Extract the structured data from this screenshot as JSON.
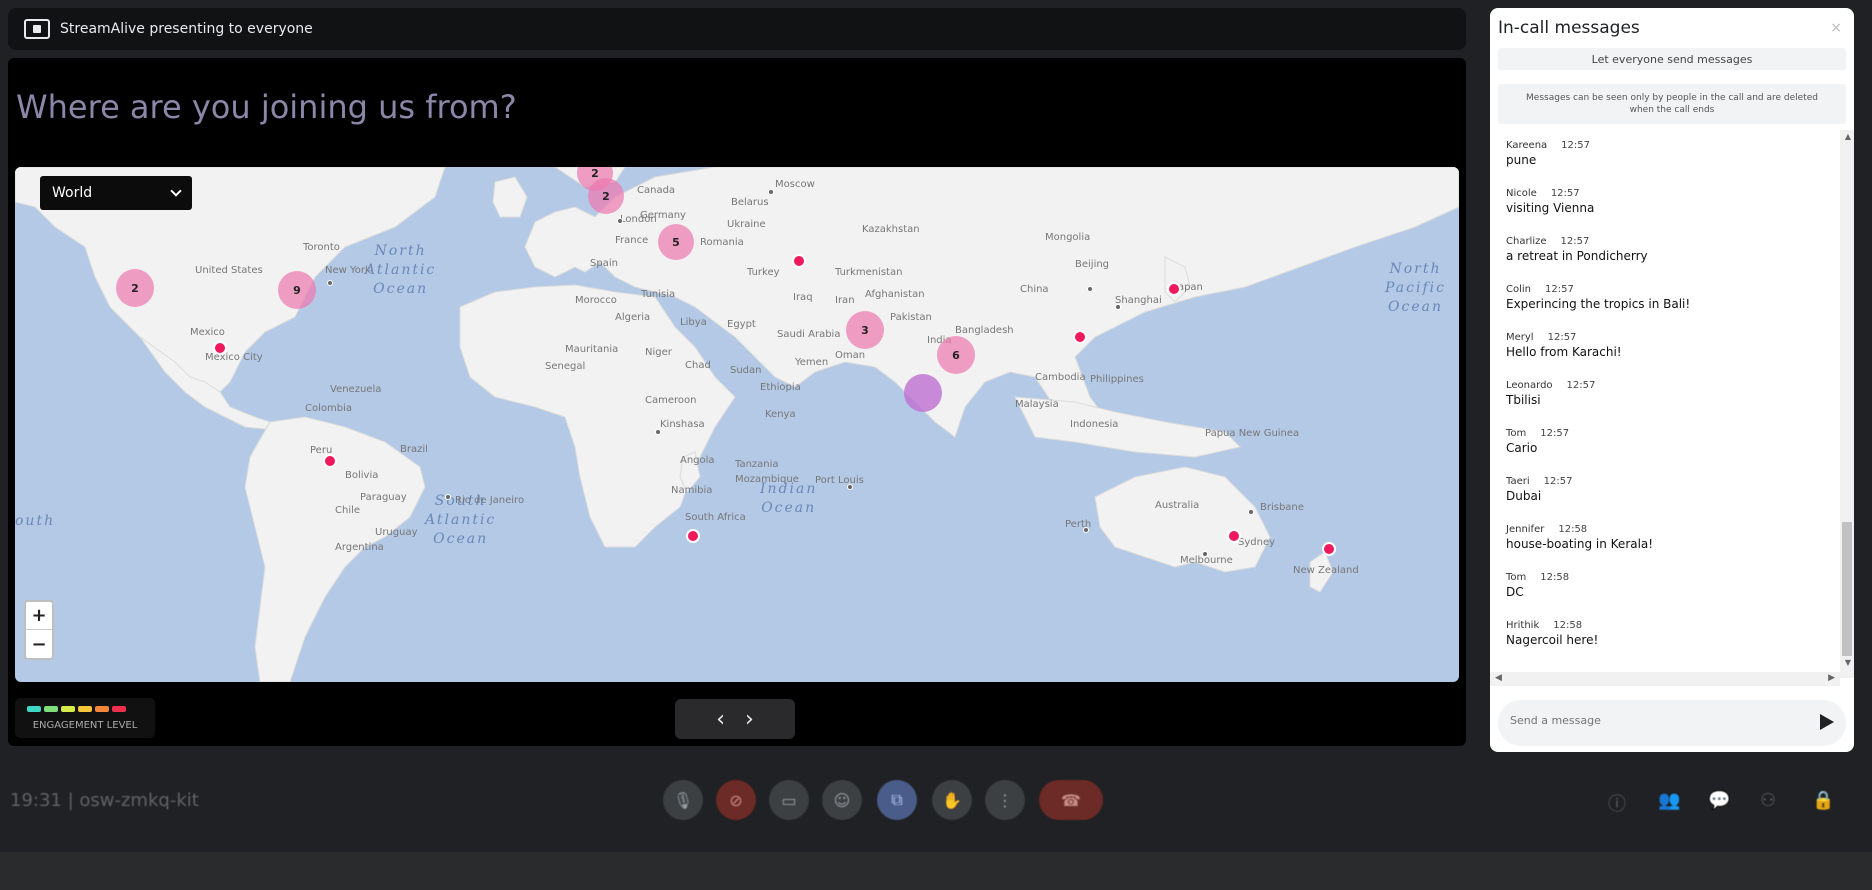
{
  "presenting": {
    "text": "StreamAlive presenting to everyone"
  },
  "stage": {
    "title": "Where are you joining us from?",
    "region_select": "World",
    "zoom_in": "+",
    "zoom_out": "−",
    "legend_label": "ENGAGEMENT LEVEL",
    "legend_colors": [
      "#3fd8c4",
      "#7ee07a",
      "#d6ec48",
      "#f6c63a",
      "#f6853a",
      "#ef2f4f"
    ],
    "prev": "‹",
    "next": "›"
  },
  "map": {
    "oceans": [
      {
        "id": "north-atlantic",
        "text": "North\nAtlantic\nOcean"
      },
      {
        "id": "north-pacific",
        "text": "North\nPacific\nOcean"
      },
      {
        "id": "south-atlantic",
        "text": "South\nAtlantic\nOcean"
      },
      {
        "id": "indian",
        "text": "Indian\nOcean"
      },
      {
        "id": "south-pacific",
        "text": "outh"
      }
    ],
    "places": [
      "Canada",
      "Moscow",
      "Belarus",
      "London",
      "Germany",
      "Ukraine",
      "Kazakhstan",
      "Mongolia",
      "France",
      "Romania",
      "Toronto",
      "New York",
      "United States",
      "Spain",
      "Turkey",
      "Turkmenistan",
      "Beijing",
      "Japan",
      "Shanghai",
      "China",
      "Iraq",
      "Iran",
      "Afghanistan",
      "Pakistan",
      "Morocco",
      "Tunisia",
      "Algeria",
      "Libya",
      "Egypt",
      "Saudi Arabia",
      "India",
      "Bangladesh",
      "Mexico",
      "Mexico City",
      "Mauritania",
      "Niger",
      "Chad",
      "Sudan",
      "Yemen",
      "Oman",
      "Senegal",
      "Ethiopia",
      "Cambodia",
      "Philippines",
      "Venezuela",
      "Colombia",
      "Cameroon",
      "Kenya",
      "Malaysia",
      "Brazil",
      "Peru",
      "Bolivia",
      "Kinshasa",
      "Indonesia",
      "Papua New Guinea",
      "Angola",
      "Tanzania",
      "Paraguay",
      "Rio de Janeiro",
      "Namibia",
      "Mozambique",
      "Port Louis",
      "Chile",
      "Australia",
      "Brisbane",
      "Uruguay",
      "South Africa",
      "Perth",
      "Sydney",
      "Argentina",
      "Melbourne",
      "New Zealand"
    ],
    "clusters": [
      "2",
      "2",
      "5",
      "2",
      "9",
      "3",
      "6",
      ""
    ]
  },
  "chat": {
    "title": "In-call messages",
    "close": "×",
    "toggle": "Let everyone send messages",
    "info": "Messages can be seen only by people in the call and are deleted when the call ends",
    "input_placeholder": "Send a message",
    "messages": [
      {
        "name": "Kareena",
        "time": "12:57",
        "text": "pune"
      },
      {
        "name": "Nicole",
        "time": "12:57",
        "text": "visiting Vienna"
      },
      {
        "name": "Charlize",
        "time": "12:57",
        "text": "a retreat in Pondicherry"
      },
      {
        "name": "Colin",
        "time": "12:57",
        "text": "Experincing the tropics in Bali!"
      },
      {
        "name": "Meryl",
        "time": "12:57",
        "text": "Hello from Karachi!"
      },
      {
        "name": "Leonardo",
        "time": "12:57",
        "text": "Tbilisi"
      },
      {
        "name": "Tom",
        "time": "12:57",
        "text": "Cario"
      },
      {
        "name": "Taeri",
        "time": "12:57",
        "text": "Dubai"
      },
      {
        "name": "Jennifer",
        "time": "12:58",
        "text": "house-boating in Kerala!"
      },
      {
        "name": "Tom",
        "time": "12:58",
        "text": "DC"
      },
      {
        "name": "Hrithik",
        "time": "12:58",
        "text": "Nagercoil here!"
      }
    ]
  },
  "bottom_bar": {
    "meeting_info": "19:31 | osw-zmkq-kit",
    "controls": {
      "mic": "🎙",
      "cam": "⊘",
      "captions": "▭",
      "emoji": "☺",
      "present": "⧉",
      "hand": "✋",
      "more": "⋮",
      "end": "☎"
    },
    "right": {
      "info": "ⓘ",
      "people": "👥",
      "chat": "💬",
      "activities": "⚇",
      "host": "🔒"
    }
  }
}
